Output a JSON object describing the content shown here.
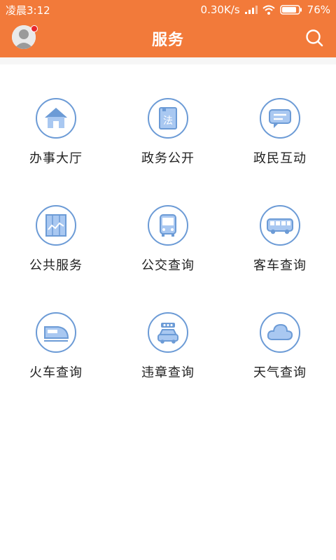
{
  "status_bar": {
    "time": "凌晨3:12",
    "network_speed": "0.30K/s",
    "battery": "76%"
  },
  "header": {
    "title": "服务"
  },
  "colors": {
    "header_bg": "#f27a3a",
    "icon_blue": "#6c9bd6",
    "icon_fill": "#a9c8f1"
  },
  "services": [
    {
      "label": "办事大厅",
      "icon": "house-icon"
    },
    {
      "label": "政务公开",
      "icon": "law-book-icon"
    },
    {
      "label": "政民互动",
      "icon": "chat-bubble-icon"
    },
    {
      "label": "公共服务",
      "icon": "chart-board-icon"
    },
    {
      "label": "公交查询",
      "icon": "bus-front-icon"
    },
    {
      "label": "客车查询",
      "icon": "coach-bus-icon"
    },
    {
      "label": "火车查询",
      "icon": "train-icon"
    },
    {
      "label": "违章查询",
      "icon": "car-icon"
    },
    {
      "label": "天气查询",
      "icon": "cloud-icon"
    }
  ]
}
